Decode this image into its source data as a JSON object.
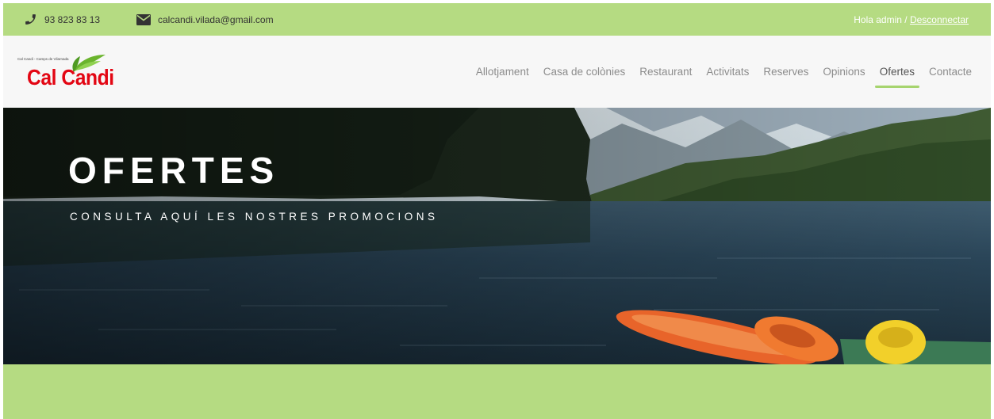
{
  "topbar": {
    "phone": "93 823 83 13",
    "email": "calcandi.vilada@gmail.com",
    "greeting": "Hola admin / ",
    "logout": "Desconnectar"
  },
  "logo": {
    "tagline": "Cal Candi - Camps de Vilarnada",
    "name": "Cal Candi"
  },
  "nav": {
    "items": [
      {
        "label": "Allotjament"
      },
      {
        "label": "Casa de colònies"
      },
      {
        "label": "Restaurant"
      },
      {
        "label": "Activitats"
      },
      {
        "label": "Reserves"
      },
      {
        "label": "Opinions"
      },
      {
        "label": "Ofertes"
      },
      {
        "label": "Contacte"
      }
    ],
    "active": "Ofertes"
  },
  "hero": {
    "title": "OFERTES",
    "subtitle": "CONSULTA AQUÍ LES NOSTRES PROMOCIONS"
  },
  "colors": {
    "accent_green": "#b5db82",
    "nav_underline": "#a6d46e",
    "logo_red": "#e30613"
  }
}
